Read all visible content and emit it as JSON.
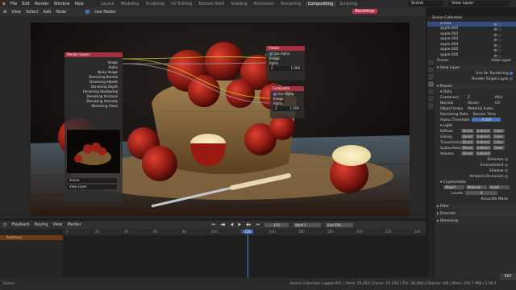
{
  "menu": [
    "File",
    "Edit",
    "Render",
    "Window",
    "Help"
  ],
  "workspaces": [
    "Layout",
    "Modeling",
    "Sculpting",
    "UV Editing",
    "Texture Paint",
    "Shading",
    "Animation",
    "Rendering",
    "Compositing",
    "Scripting"
  ],
  "active_workspace": "Compositing",
  "scene_name": "Scene",
  "view_layer_name": "View Layer",
  "node_header": {
    "items": [
      "View",
      "Select",
      "Add",
      "Node"
    ],
    "use_nodes": "Use Nodes",
    "backdrop": "Backdrop"
  },
  "nodes": {
    "render_layers": {
      "title": "Render Layers",
      "outputs": [
        "Image",
        "Alpha",
        "Noisy Image",
        "Denoising Normal",
        "Denoising Albedo",
        "Denoising Depth",
        "Denoising Shadowing",
        "Denoising Variance",
        "Denoising Intensity",
        "Denoising Clean"
      ],
      "scene": "Scene",
      "layer": "View Layer"
    },
    "viewer": {
      "title": "Viewer",
      "use_alpha": "Use Alpha",
      "inputs": [
        "Image",
        "Alpha"
      ],
      "z_label": "Z",
      "z_value": "1.000"
    },
    "composite": {
      "title": "Composite",
      "use_alpha": "Use Alpha",
      "inputs": [
        "Image",
        "Alpha"
      ],
      "z_label": "Z",
      "z_value": "1.000"
    }
  },
  "outliner": {
    "title": "Scene Collection",
    "rows": [
      "scene",
      "apple.001",
      "apple.002",
      "apple.003",
      "apple.004",
      "apple.005",
      "apple.006"
    ],
    "selected_index": 0
  },
  "properties": {
    "header": [
      "Scene",
      "View Layer"
    ],
    "panel_title": "View Layer",
    "use_for_rendering": "Use for Rendering",
    "render_single_layer": "Render Single Layer",
    "passes": "Passes",
    "data": "Data",
    "data_rows": [
      [
        "Combined",
        "Z",
        "Mist"
      ],
      [
        "Normal",
        "Vector",
        "UV"
      ],
      [
        "Object Index",
        "Material Index",
        ""
      ]
    ],
    "denoising_data": "Denoising Data",
    "render_time": "Render Time",
    "alpha_threshold_label": "Alpha Threshold",
    "alpha_threshold_value": "0.500",
    "light": "Light",
    "light_rows": [
      [
        "Diffuse",
        "Direct",
        "Indirect",
        "Color"
      ],
      [
        "Glossy",
        "Direct",
        "Indirect",
        "Color"
      ],
      [
        "Transmission",
        "Direct",
        "Indirect",
        "Color"
      ],
      [
        "Subsurface",
        "Direct",
        "Indirect",
        "Color"
      ],
      [
        "Volume",
        "Direct",
        "Indirect",
        ""
      ]
    ],
    "emission": "Emission",
    "environment": "Environment",
    "shadow": "Shadow",
    "ambient_occlusion": "Ambient Occlusion",
    "cryptomatte": "Cryptomatte",
    "crypto_buttons": [
      "Object",
      "Material",
      "Asset"
    ],
    "levels_label": "Levels",
    "levels_value": "6",
    "accurate_mode": "Accurate Mode",
    "filter": "Filter",
    "override": "Override",
    "denoising": "Denoising"
  },
  "timeline": {
    "menu": [
      "Playback",
      "Keying",
      "View",
      "Marker"
    ],
    "summary": "Summary",
    "frame_current": "120",
    "start_label": "Start",
    "start": "1",
    "end_label": "End",
    "end": "250",
    "ticks": [
      "0",
      "20",
      "40",
      "60",
      "80",
      "100",
      "120",
      "140",
      "160",
      "180",
      "200",
      "220",
      "240"
    ]
  },
  "status": {
    "left": "Scene",
    "right": "Scene Collection | apple.001 | Verts: 15,452 | Faces: 15,234 | Tris: 30,468 | Objects: 0/6 | Mem: 150.7 MiB | 2.90.1"
  },
  "ctrl_badge": "Ctrl",
  "colors": {
    "accent": "#4772b3",
    "node_red": "#c2374f",
    "summary_orange": "#6a3b16",
    "playhead": "#4a7fd0"
  }
}
